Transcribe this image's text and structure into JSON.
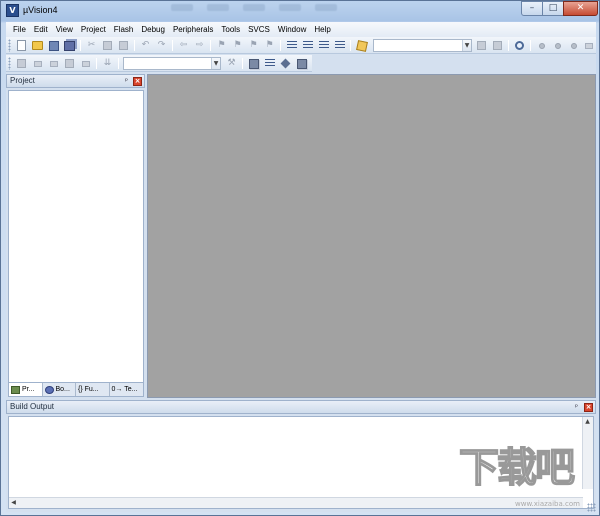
{
  "window": {
    "title": "µVision4",
    "app_icon_text": "V",
    "min_glyph": "–",
    "max_glyph": "□",
    "close_glyph": "✕"
  },
  "menubar": {
    "items": [
      "File",
      "Edit",
      "View",
      "Project",
      "Flash",
      "Debug",
      "Peripherals",
      "Tools",
      "SVCS",
      "Window",
      "Help"
    ]
  },
  "toolbar": {
    "target_combo_value": "",
    "build_target_combo_value": ""
  },
  "project_panel": {
    "title": "Project",
    "pin_glyph": "ᵖ",
    "close_glyph": "×",
    "tabs": [
      {
        "label": "Pr...",
        "icon": "project-tab-icon"
      },
      {
        "label": "Bo...",
        "icon": "books-tab-icon"
      },
      {
        "label": "{} Fu...",
        "icon": "functions-tab-icon"
      },
      {
        "label": "0→ Te...",
        "icon": "templates-tab-icon"
      }
    ]
  },
  "build_panel": {
    "title": "Build Output",
    "pin_glyph": "ᵖ",
    "close_glyph": "×"
  },
  "watermark": {
    "text": "下载吧",
    "url": "www.xiazaiba.com"
  },
  "colors": {
    "editor_background": "#a2a2a2",
    "chrome": "#d4e0ef",
    "close_button": "#c64b32"
  }
}
